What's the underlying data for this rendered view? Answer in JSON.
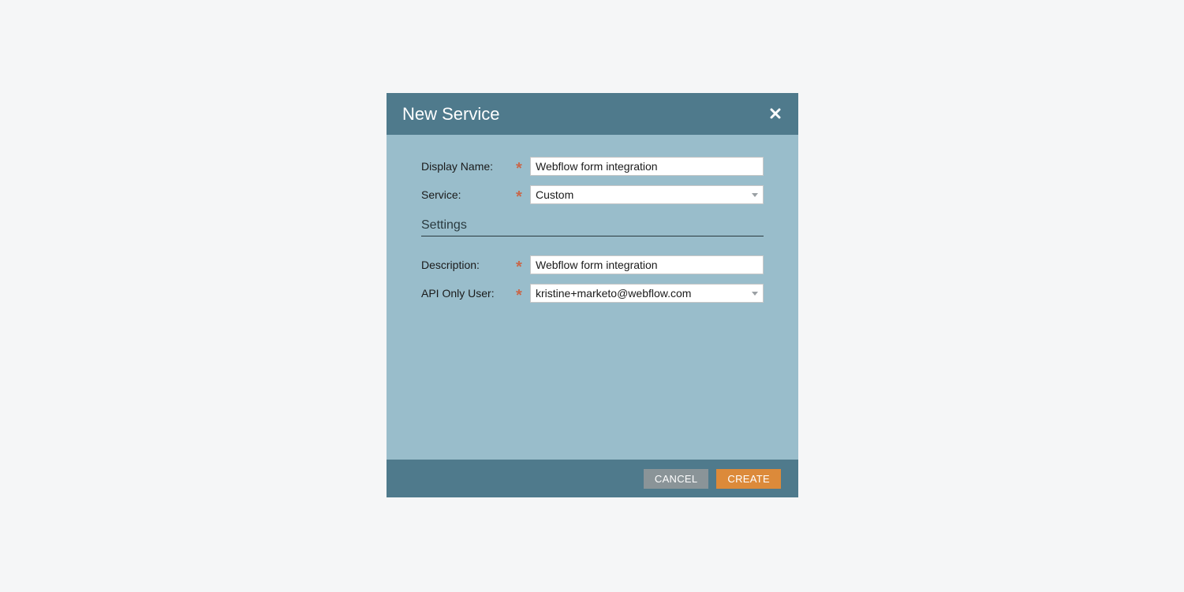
{
  "dialog": {
    "title": "New Service",
    "fields": {
      "display_name": {
        "label": "Display Name:",
        "value": "Webflow form integration"
      },
      "service": {
        "label": "Service:",
        "value": "Custom"
      },
      "description": {
        "label": "Description:",
        "value": "Webflow form integration"
      },
      "api_only_user": {
        "label": "API Only User:",
        "value": "kristine+marketo@webflow.com"
      }
    },
    "settings_heading": "Settings",
    "required_marker": "*",
    "buttons": {
      "cancel": "CANCEL",
      "create": "CREATE"
    }
  }
}
